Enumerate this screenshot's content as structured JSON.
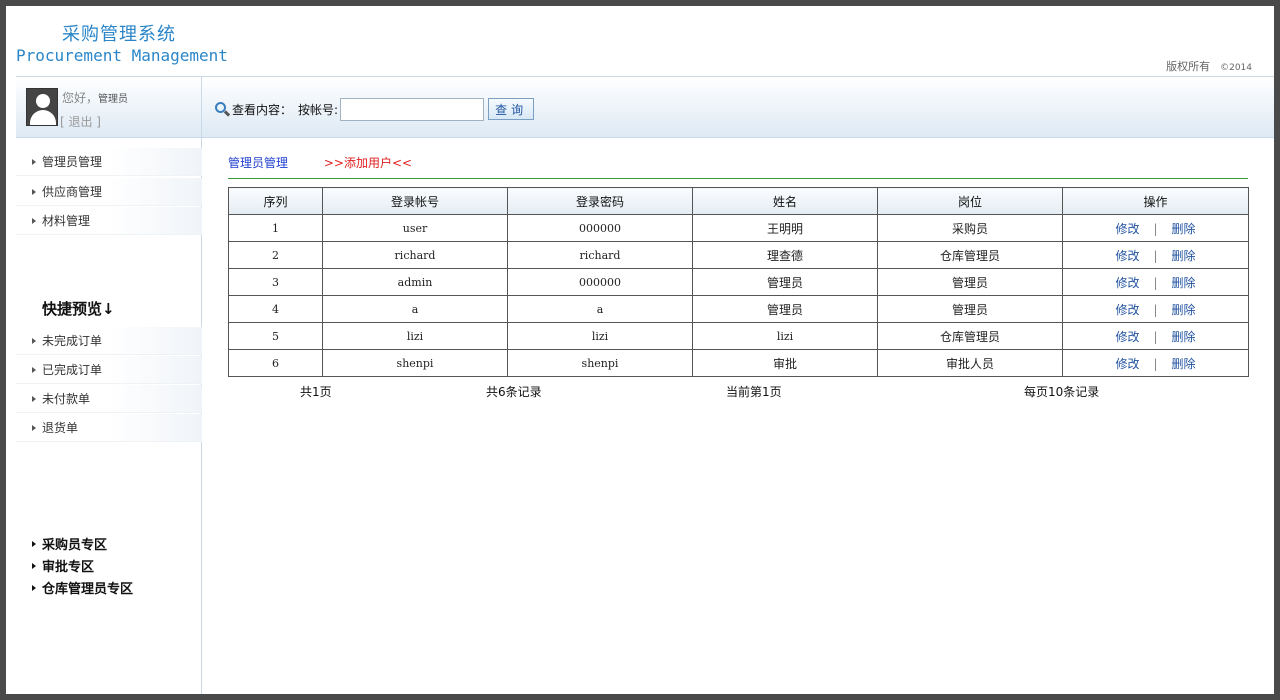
{
  "header": {
    "title_cn": "采购管理系统",
    "title_en": "Procurement Management",
    "copyright": "版权所有",
    "copyright_year": "©2014"
  },
  "user": {
    "greeting": "您好，",
    "role": "管理员",
    "logout": "[ 退出 ]"
  },
  "search": {
    "label": "查看内容：",
    "by_label": "按帐号:",
    "value": "",
    "button": "查询"
  },
  "sidebar": {
    "items": [
      {
        "label": "管理员管理"
      },
      {
        "label": "供应商管理"
      },
      {
        "label": "材料管理"
      }
    ],
    "quick_title": "快捷预览↓",
    "quick_items": [
      {
        "label": "未完成订单"
      },
      {
        "label": "已完成订单"
      },
      {
        "label": "未付款单"
      },
      {
        "label": "退货单"
      }
    ],
    "zones": [
      {
        "label": "采购员专区"
      },
      {
        "label": "审批专区"
      },
      {
        "label": "仓库管理员专区"
      }
    ]
  },
  "main": {
    "breadcrumb": "管理员管理",
    "add_link": ">>添加用户<<",
    "table": {
      "columns": [
        "序列",
        "登录帐号",
        "登录密码",
        "姓名",
        "岗位",
        "操作"
      ],
      "rows": [
        {
          "seq": "1",
          "account": "user",
          "password": "000000",
          "name": "王明明",
          "position": "采购员",
          "edit": "修改",
          "delete": "删除"
        },
        {
          "seq": "2",
          "account": "richard",
          "password": "richard",
          "name": "理查德",
          "position": "仓库管理员",
          "edit": "修改",
          "delete": "删除"
        },
        {
          "seq": "3",
          "account": "admin",
          "password": "000000",
          "name": "管理员",
          "position": "管理员",
          "edit": "修改",
          "delete": "删除"
        },
        {
          "seq": "4",
          "account": "a",
          "password": "a",
          "name": "管理员",
          "position": "管理员",
          "edit": "修改",
          "delete": "删除"
        },
        {
          "seq": "5",
          "account": "lizi",
          "password": "lizi",
          "name": "lizi",
          "position": "仓库管理员",
          "edit": "修改",
          "delete": "删除"
        },
        {
          "seq": "6",
          "account": "shenpi",
          "password": "shenpi",
          "name": "审批",
          "position": "审批人员",
          "edit": "修改",
          "delete": "删除"
        }
      ]
    },
    "pager": {
      "total_pages": "共1页",
      "total_records": "共6条记录",
      "current_page": "当前第1页",
      "per_page": "每页10条记录"
    }
  }
}
